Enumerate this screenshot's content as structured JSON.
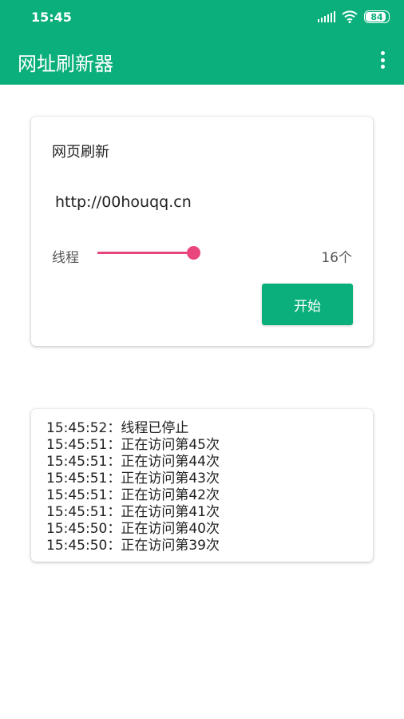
{
  "status_bar": {
    "time": "15:45",
    "battery": "84"
  },
  "app_bar": {
    "title": "网址刷新器"
  },
  "refresh_card": {
    "heading": "网页刷新",
    "url_value": "http://00houqq.cn",
    "thread_label": "线程",
    "thread_slider_level_percent": 100,
    "thread_count": "16个",
    "start_label": "开始"
  },
  "log": [
    "15:45:52：线程已停止",
    "15:45:51：正在访问第45次",
    "15:45:51：正在访问第44次",
    "15:45:51：正在访问第43次",
    "15:45:51：正在访问第42次",
    "15:45:51：正在访问第41次",
    "15:45:50：正在访问第40次",
    "15:45:50：正在访问第39次"
  ],
  "colors": {
    "primary": "#0aaf7c",
    "accent": "#e8467c"
  },
  "icons": [
    "signal-icon",
    "wifi-icon",
    "battery-icon",
    "more-vert-icon"
  ]
}
